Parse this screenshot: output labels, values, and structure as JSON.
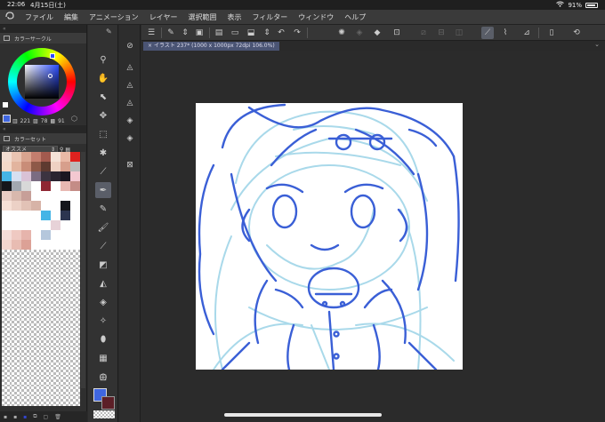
{
  "status": {
    "time": "22:06",
    "date": "4月15日(土)",
    "battery": "91%"
  },
  "menu": {
    "items": [
      "ファイル",
      "編集",
      "アニメーション",
      "レイヤー",
      "選択範囲",
      "表示",
      "フィルター",
      "ウィンドウ",
      "ヘルプ"
    ]
  },
  "palette": {
    "colorcircle_title": "カラーサークル",
    "hsv": {
      "h": "221",
      "s": "78",
      "v": "91"
    },
    "colorset_title": "カラーセット",
    "colorset_selected": "オススメ",
    "swatches": [
      "#f1dcd0",
      "#e9c4b2",
      "#d9a48f",
      "#c47e6e",
      "#a35a4e",
      "#f5e1d6",
      "#eab9a6",
      "#e0221f",
      "#f3d9c9",
      "#e2b49e",
      "#c98d78",
      "#8e5948",
      "#5e3a30",
      "#efd1c3",
      "#d79f8c",
      "#bbbbbb",
      "#45b5e6",
      "#d6dff0",
      "#d9c2d6",
      "#7b6c82",
      "#3c3340",
      "#2a2430",
      "#1b1620",
      "#f3c8d1",
      "#14161b",
      "#a2a8b0",
      "#d8d8d8",
      "#ffffff",
      "#8f2733",
      "#ffffff",
      "#e8b8b2",
      "#c48c86",
      "#e7ccc4",
      "#d8b8ad",
      "#c79f98",
      "#ffffff",
      "#ffffff",
      "#ffffff",
      "#ffffff",
      "#ffffff",
      "#f6e0d6",
      "#ecd1c6",
      "#e2c2b6",
      "#d7b3a7",
      "#ffffff",
      "#ffffff",
      "#14161b",
      "#ffffff",
      "#ffffff",
      "#ffffff",
      "#ffffff",
      "#ffffff",
      "#45b5e6",
      "#ffffff",
      "#2c3550",
      "#ffffff",
      "#ffffff",
      "#ffffff",
      "#ffffff",
      "#ffffff",
      "#ffffff",
      "#e7d2d8",
      "#ffffff",
      "#ffffff",
      "#f5dcd8",
      "#efc9c2",
      "#e6b4ac",
      "#ffffff",
      "#b5c7dc",
      "#ffffff",
      "#ffffff",
      "#ffffff",
      "#f3d5cd",
      "#e8bcb2",
      "#dca196",
      "#ffffff",
      "#ffffff",
      "#ffffff",
      "#ffffff",
      "#ffffff"
    ],
    "empty_rows": 16
  },
  "colors": {
    "main": "#3f66e0",
    "sub": "#5c1f27",
    "accent": "#5a5e68",
    "tab": "#4a5474",
    "sketch_dark": "#3a5fd6",
    "sketch_light": "#a9d9ea"
  },
  "document": {
    "tab_label": "イラスト 237* (1000 x 1000px 72dpi 106.0%)"
  }
}
